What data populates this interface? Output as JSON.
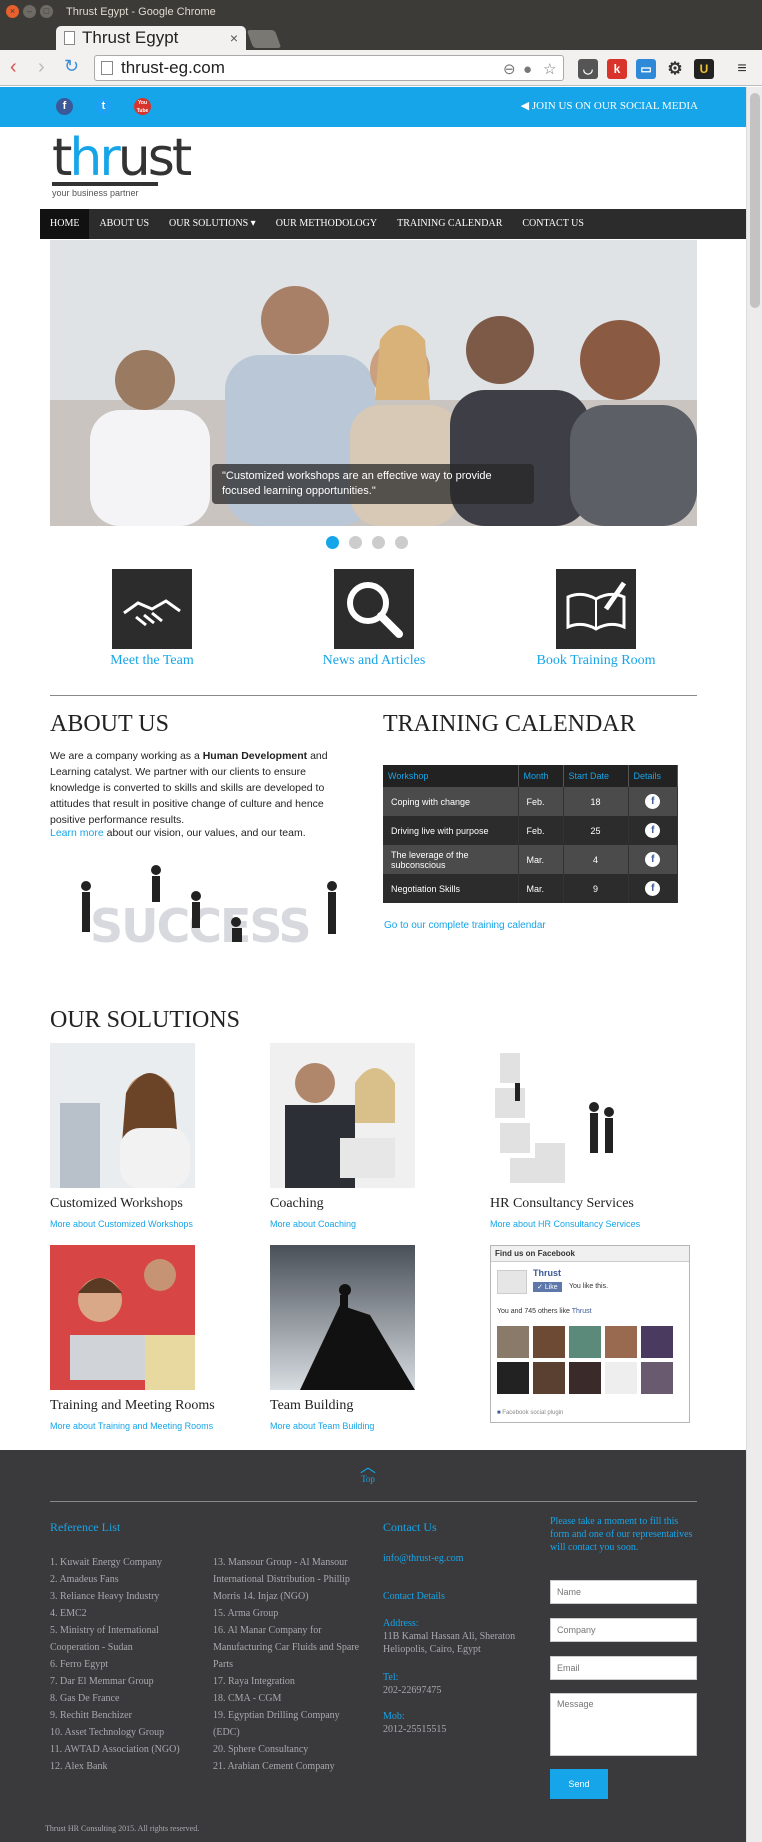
{
  "window": {
    "title": "Thrust Egypt - Google Chrome"
  },
  "tab": {
    "title": "Thrust Egypt",
    "close": "×"
  },
  "browser": {
    "url": "thrust-eg.com"
  },
  "topbar": {
    "social": [
      "f",
      "t",
      "You Tube"
    ],
    "join": "JOIN US ON OUR SOCIAL MEDIA"
  },
  "logo": {
    "wordmark": "thrust",
    "tagline": "your business partner"
  },
  "nav": [
    "HOME",
    "ABOUT US",
    "OUR SOLUTIONS",
    "OUR METHODOLOGY",
    "TRAINING CALENDAR",
    "CONTACT US"
  ],
  "slider": {
    "caption": "\"Customized workshops are an effective way to provide focused learning opportunities.\"",
    "active_dot": 1,
    "dot_count": 4
  },
  "features": [
    "Meet the Team",
    "News and Articles",
    "Book Training Room"
  ],
  "about": {
    "heading": "ABOUT US",
    "text_pre": "We are a company working as a ",
    "text_bold": "Human Development",
    "text_post": " and Learning catalyst. We partner with our clients to ensure knowledge is converted to skills and skills are developed to attitudes that result in positive change of culture and hence positive performance results.",
    "learn_link": "Learn more",
    "learn_rest": " about our vision, our values, and our team.",
    "image_text": "SUCCESS"
  },
  "calendar": {
    "heading": "TRAINING CALENDAR",
    "columns": [
      "Workshop",
      "Month",
      "Start Date",
      "Details"
    ],
    "rows": [
      {
        "workshop": "Coping with change",
        "month": "Feb.",
        "start": "18"
      },
      {
        "workshop": "Driving live with purpose",
        "month": "Feb.",
        "start": "25"
      },
      {
        "workshop": "The leverage of the subconscious",
        "month": "Mar.",
        "start": "4"
      },
      {
        "workshop": "Negotiation Skills",
        "month": "Mar.",
        "start": "9"
      }
    ],
    "link": "Go to our complete training calendar"
  },
  "solutions": {
    "heading": "OUR SOLUTIONS",
    "items": [
      {
        "title": "Customized Workshops",
        "more": "More about Customized Workshops"
      },
      {
        "title": "Coaching",
        "more": "More about Coaching"
      },
      {
        "title": "HR Consultancy Services",
        "more": "More about HR Consultancy Services"
      },
      {
        "title": "Training and Meeting Rooms",
        "more": "More about Training and Meeting Rooms"
      },
      {
        "title": "Team Building",
        "more": "More about Team Building"
      }
    ]
  },
  "facebook": {
    "header": "Find us on Facebook",
    "page": "Thrust",
    "like": "Like",
    "you_like": "You like this.",
    "count_pre": "You and 745 others like ",
    "count_link": "Thrust",
    "plugin": "Facebook social plugin"
  },
  "footer": {
    "top": "Top",
    "ref_heading": "Reference List",
    "refs_col1": [
      "1. Kuwait Energy Company",
      "2. Amadeus Fans",
      "3. Reliance Heavy Industry",
      "4. EMC2",
      "5. Ministry of International Cooperation - Sudan",
      "6. Ferro Egypt",
      "7. Dar El Memmar Group",
      "8. Gas De France",
      "9. Rechitt Benchizer",
      "10. Asset Technology Group",
      "11. AWTAD Association (NGO)",
      "12. Alex Bank"
    ],
    "refs_col2": [
      "13. Mansour Group - Al Mansour International Distribution - Phillip Morris 14. Injaz (NGO)",
      "15. Arma Group",
      "16. Al Manar Company for Manufacturing Car Fluids and Spare Parts",
      "17. Raya Integration",
      "18. CMA - CGM",
      "19. Egyptian Drilling Company (EDC)",
      "20. Sphere Consultancy",
      "21. Arabian Cement Company"
    ],
    "contact_heading": "Contact Us",
    "email": "info@thrust-eg.com",
    "details_heading": "Contact Details",
    "address_label": "Address:",
    "address": "11B Kamal Hassan Ali, Sheraton Heliopolis, Cairo, Egypt",
    "tel_label": "Tel:",
    "tel": "202-22697475",
    "mob_label": "Mob:",
    "mob": "2012-25515515",
    "form_intro": "Please take a moment to fill this form and one of our representatives will contact you soon.",
    "ph_name": "Name",
    "ph_company": "Company",
    "ph_email": "Email",
    "ph_message": "Message",
    "send": "Send",
    "copyright": "Thrust HR Consulting 2015. All rights reserved."
  }
}
